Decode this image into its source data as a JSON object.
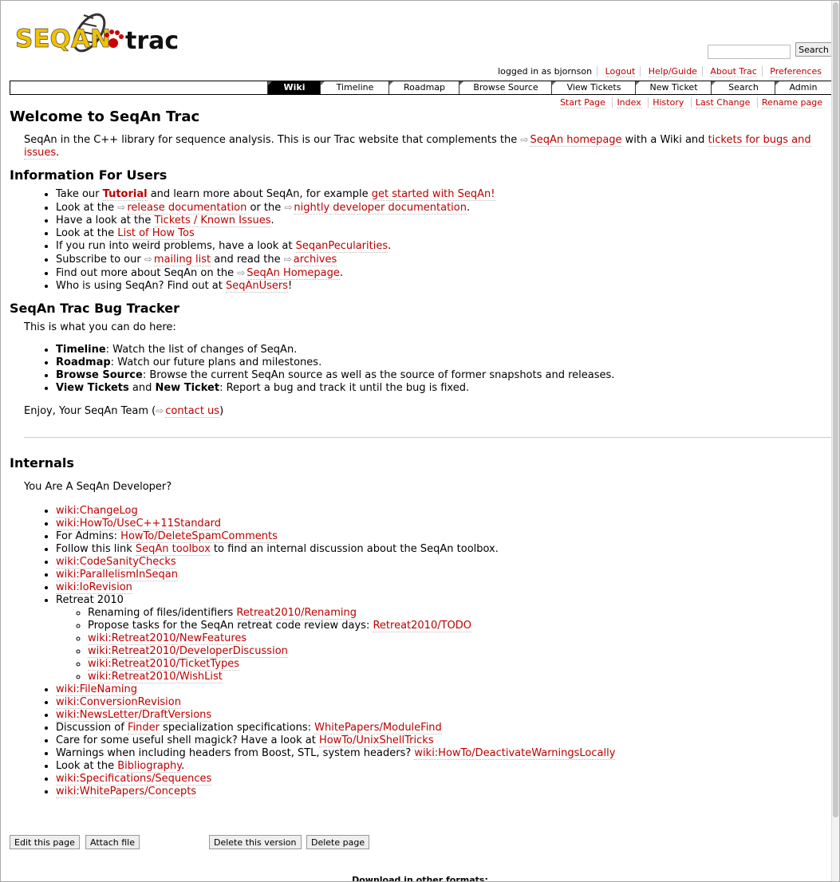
{
  "logo": {
    "text1": "SEQAN",
    "text2": "trac"
  },
  "search": {
    "placeholder": "",
    "button": "Search"
  },
  "metanav": [
    "logged in as bjornson",
    "Logout",
    "Help/Guide",
    "About Trac",
    "Preferences"
  ],
  "mainnav": [
    "Wiki",
    "Timeline",
    "Roadmap",
    "Browse Source",
    "View Tickets",
    "New Ticket",
    "Search",
    "Admin"
  ],
  "ctxnav": [
    "Start Page",
    "Index",
    "History",
    "Last Change",
    "Rename page"
  ],
  "page": {
    "title": "Welcome to SeqAn Trac",
    "intro_a": "SeqAn in the C++ library for sequence analysis. This is our Trac website that complements the ",
    "intro_link1": "SeqAn homepage",
    "intro_b": " with a Wiki and ",
    "intro_link2": "tickets for bugs and issues",
    "intro_c": ".",
    "users_heading": "Information For Users",
    "users": {
      "l1a": "Take our ",
      "l1b": "Tutorial",
      "l1c": " and learn more about SeqAn, for example ",
      "l1d": "get started with SeqAn!",
      "l2a": "Look at the ",
      "l2b": "release documentation",
      "l2c": " or the ",
      "l2d": "nightly developer documentation",
      "l2e": ".",
      "l3a": "Have a look at the ",
      "l3b": "Tickets / Known Issues",
      "l3c": ".",
      "l4a": "Look at the ",
      "l4b": "List of How Tos",
      "l5a": "If you run into weird problems, have a look at ",
      "l5b": "SeqanPecularities",
      "l5c": ".",
      "l6a": "Subscribe to our ",
      "l6b": "mailing list",
      "l6c": " and read the ",
      "l6d": "archives",
      "l7a": "Find out more about SeqAn on the ",
      "l7b": "SeqAn Homepage",
      "l7c": ".",
      "l8a": "Who is using SeqAn? Find out at ",
      "l8b": "SeqAnUsers",
      "l8c": "!"
    },
    "bug_heading": "SeqAn Trac Bug Tracker",
    "bug_intro": "This is what you can do here:",
    "bug": {
      "b1a": "Timeline",
      "b1b": ": Watch the list of changes of SeqAn.",
      "b2a": "Roadmap",
      "b2b": ": Watch our future plans and milestones.",
      "b3a": "Browse Source",
      "b3b": ": Browse the current SeqAn source as well as the source of former snapshots and releases.",
      "b4a": "View Tickets",
      "b4b": " and ",
      "b4c": "New Ticket",
      "b4d": ": Report a bug and track it until the bug is fixed."
    },
    "enjoy_a": "Enjoy, Your SeqAn Team (",
    "enjoy_link": "contact us",
    "enjoy_b": ")",
    "internals_heading": "Internals",
    "internals_intro": "You Are A SeqAn Developer?",
    "internals": {
      "i1": "wiki:ChangeLog",
      "i2": "wiki:HowTo/UseC++11Standard",
      "i3a": "For Admins: ",
      "i3b": "HowTo/DeleteSpamComments",
      "i4a": "Follow this link ",
      "i4b": "SeqAn toolbox",
      "i4c": " to find an internal discussion about the SeqAn toolbox.",
      "i5": "wiki:CodeSanityChecks",
      "i6": "wiki:ParallelismInSeqan",
      "i7": "wiki:IoRevision",
      "i8": "Retreat 2010",
      "r1a": "Renaming of files/identifiers ",
      "r1b": "Retreat2010/Renaming",
      "r2a": "Propose tasks for the SeqAn retreat code review days: ",
      "r2b": "Retreat2010/TODO",
      "r3": "wiki:Retreat2010/NewFeatures",
      "r4": "wiki:Retreat2010/DeveloperDiscussion",
      "r5": "wiki:Retreat2010/TicketTypes",
      "r6": "wiki:Retreat2010/WishList",
      "i9": "wiki:FileNaming",
      "i10": "wiki:ConversionRevision",
      "i11": "wiki:NewsLetter/DraftVersions",
      "i12a": "Discussion of ",
      "i12b": "Finder",
      "i12c": " specialization specifications: ",
      "i12d": "WhitePapers/ModuleFind",
      "i13a": "Care for some useful shell magick? Have a look at ",
      "i13b": "HowTo/UnixShellTricks",
      "i14a": "Warnings when including headers from Boost, STL, system headers? ",
      "i14b": "wiki:HowTo/DeactivateWarningsLocally",
      "i15a": "Look at the ",
      "i15b": "Bibliography",
      "i15c": ".",
      "i16": "wiki:Specifications/Sequences",
      "i17": "wiki:WhitePapers/Concepts"
    }
  },
  "buttons": [
    "Edit this page",
    "Attach file",
    "Delete this version",
    "Delete page"
  ],
  "download": "Download in other formats:",
  "ext_icon": "external-link-icon"
}
